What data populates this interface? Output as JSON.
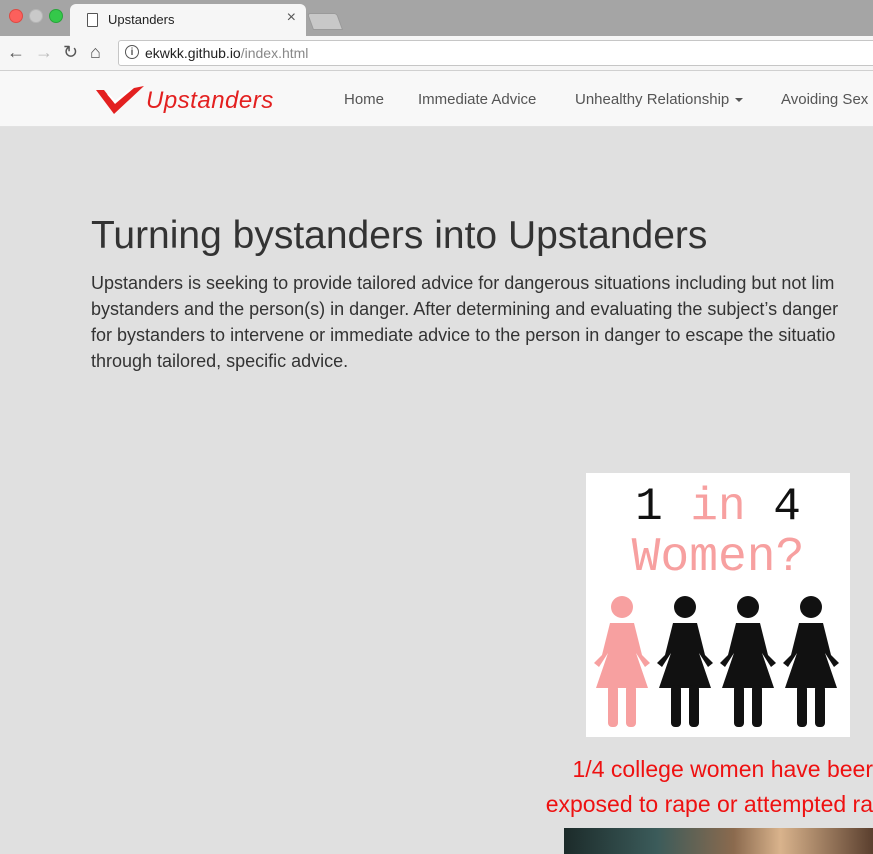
{
  "browser": {
    "tab_title": "Upstanders",
    "tab_close": "×",
    "url_host": "ekwkk.github.io",
    "url_path": "/index.html",
    "back_glyph": "←",
    "forward_glyph": "→",
    "reload_glyph": "↻",
    "home_glyph": "⌂",
    "info_glyph": "i"
  },
  "navbar": {
    "brand": "Upstanders",
    "links": [
      {
        "label": "Home"
      },
      {
        "label": "Immediate Advice"
      },
      {
        "label": "Unhealthy Relationship",
        "has_dropdown": true
      },
      {
        "label": "Avoiding Sex"
      }
    ]
  },
  "hero": {
    "title": "Turning bystanders into Upstanders",
    "lines": [
      "Upstanders is seeking to provide tailored advice for dangerous situations including but not lim",
      "bystanders and the person(s) in danger. After determining and evaluating the subject’s danger",
      "for bystanders to intervene or immediate advice to the person in danger to escape the situatio",
      "through tailored, specific advice."
    ]
  },
  "infographic": {
    "part1": "1 ",
    "part2": "in",
    "part3": " 4",
    "line2": "Women?",
    "colors": {
      "pink": "#f7a0a0",
      "black": "#111111"
    }
  },
  "stat": {
    "line1": "1/4 college women have beer",
    "line2": "exposed to rape or attempted ra"
  },
  "colors": {
    "brand": "#e32020",
    "stat": "#ee1111",
    "page_bg": "#e0e0e0"
  }
}
